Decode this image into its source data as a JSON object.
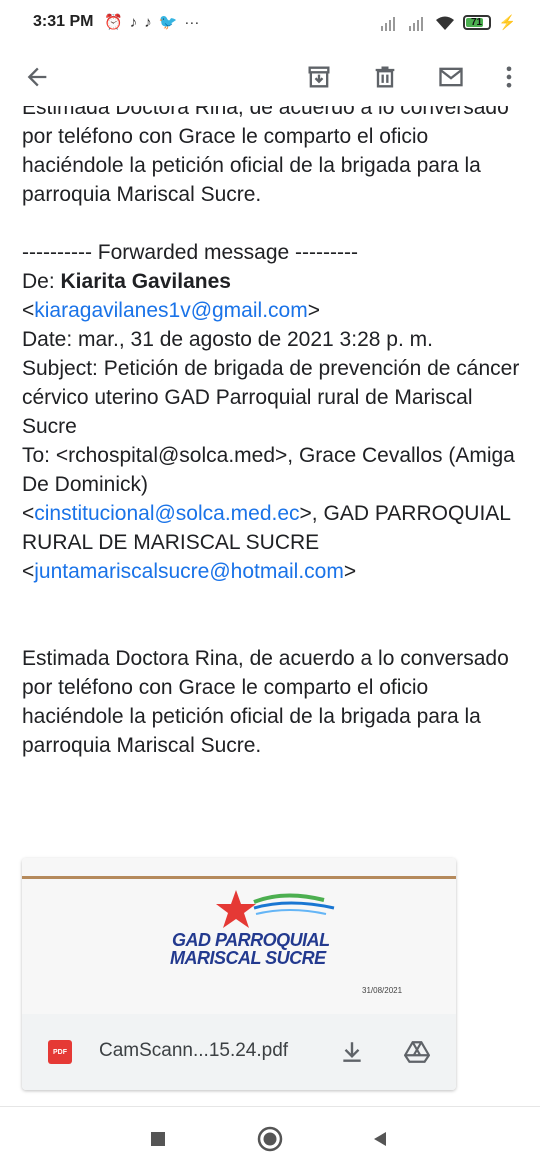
{
  "status_bar": {
    "time": "3:31 PM",
    "notif_icons": [
      "alarm-icon",
      "tiktok-icon",
      "tiktok-icon",
      "twitter-icon",
      "more-dots-icon"
    ],
    "more": "···",
    "battery_level": "71"
  },
  "toolbar": {
    "back": "back-arrow-icon",
    "archive": "archive-icon",
    "delete": "trash-icon",
    "mark_unread": "mail-icon",
    "overflow": "more-vert-icon"
  },
  "email": {
    "top_para": "Estimada Doctora Rina, de acuerdo a lo conversado por teléfono con Grace le comparto el oficio haciéndole la petición oficial de la brigada para la parroquia Mariscal Sucre.",
    "forward_header": "---------- Forwarded message ---------",
    "from_label": "De: ",
    "from_name": "Kiarita Gavilanes",
    "from_email": "kiaragavilanes1v@gmail.com",
    "lt": "<",
    "gt": ">",
    "date_line": "Date: mar., 31 de agosto de 2021 3:28 p. m.",
    "subject_line": "Subject: Petición de brigada de prevención de cáncer cérvico uterino GAD Parroquial rural de Mariscal Sucre",
    "to_line_1": "To: <rchospital@solca.med>, Grace Cevallos (Amiga De Dominick)",
    "cc_email_1": "cinstitucional@solca.med.ec",
    "to_line_2": ">, GAD PARROQUIAL RURAL DE MARISCAL SUCRE",
    "cc_email_2": "juntamariscalsucre@hotmail.com",
    "body_para": "Estimada Doctora Rina, de acuerdo a lo conversado por teléfono con Grace le comparto el oficio haciéndole la petición oficial de la brigada para la parroquia Mariscal Sucre."
  },
  "attachment": {
    "preview_org_line1": "GAD PARROQUIAL",
    "preview_org_line2": "MARISCAL SUCRE",
    "preview_date": "31/08/2021",
    "type_badge": "PDF",
    "filename": "CamScann...15.24.pdf",
    "download": "download-icon",
    "drive": "drive-icon"
  },
  "colors": {
    "link": "#1a73e8",
    "accent_red": "#e53935",
    "org_blue": "#233a8f"
  }
}
